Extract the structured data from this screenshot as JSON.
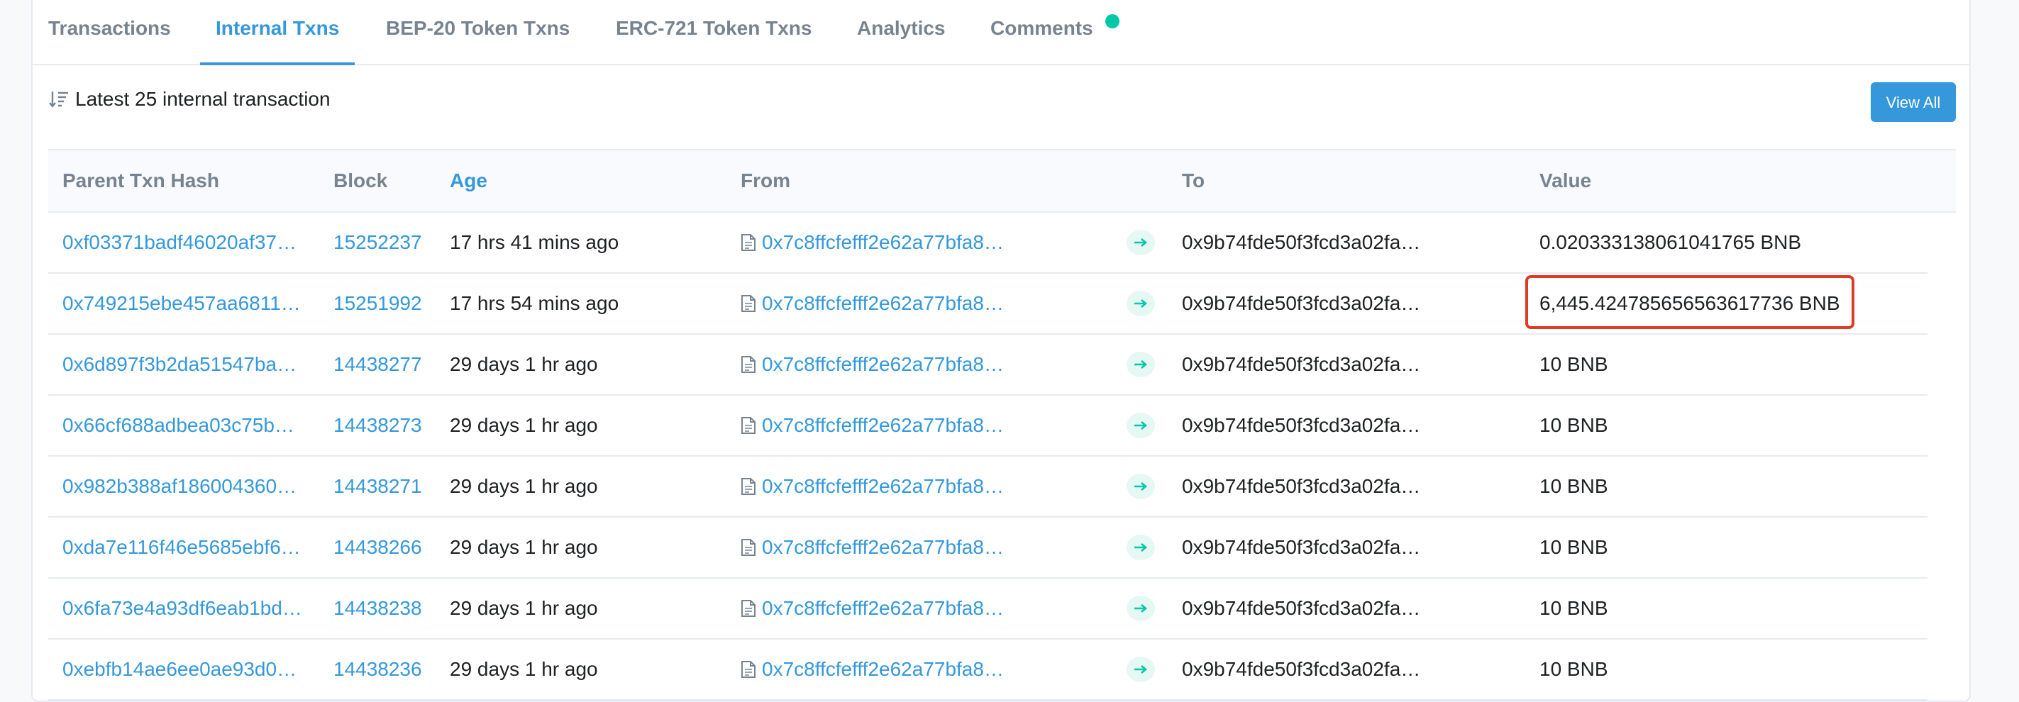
{
  "tabs": [
    {
      "label": "Transactions",
      "active": false
    },
    {
      "label": "Internal Txns",
      "active": true
    },
    {
      "label": "BEP-20 Token Txns",
      "active": false
    },
    {
      "label": "ERC-721 Token Txns",
      "active": false
    },
    {
      "label": "Analytics",
      "active": false
    },
    {
      "label": "Comments",
      "active": false
    }
  ],
  "summary": "Latest 25 internal transaction",
  "view_all_label": "View All",
  "columns": {
    "hash": "Parent Txn Hash",
    "block": "Block",
    "age": "Age",
    "from": "From",
    "to": "To",
    "value": "Value"
  },
  "rows": [
    {
      "hash": "0xf03371badf46020af37…",
      "block": "15252237",
      "age": "17 hrs 41 mins ago",
      "from": "0x7c8ffcfefff2e62a77bfa8…",
      "to": "0x9b74fde50f3fcd3a02fa…",
      "value": "0.020333138061041765 BNB",
      "highlighted": false
    },
    {
      "hash": "0x749215ebe457aa6811…",
      "block": "15251992",
      "age": "17 hrs 54 mins ago",
      "from": "0x7c8ffcfefff2e62a77bfa8…",
      "to": "0x9b74fde50f3fcd3a02fa…",
      "value": "6,445.424785656563617736 BNB",
      "highlighted": true
    },
    {
      "hash": "0x6d897f3b2da51547ba…",
      "block": "14438277",
      "age": "29 days 1 hr ago",
      "from": "0x7c8ffcfefff2e62a77bfa8…",
      "to": "0x9b74fde50f3fcd3a02fa…",
      "value": "10 BNB",
      "highlighted": false
    },
    {
      "hash": "0x66cf688adbea03c75b…",
      "block": "14438273",
      "age": "29 days 1 hr ago",
      "from": "0x7c8ffcfefff2e62a77bfa8…",
      "to": "0x9b74fde50f3fcd3a02fa…",
      "value": "10 BNB",
      "highlighted": false
    },
    {
      "hash": "0x982b388af186004360…",
      "block": "14438271",
      "age": "29 days 1 hr ago",
      "from": "0x7c8ffcfefff2e62a77bfa8…",
      "to": "0x9b74fde50f3fcd3a02fa…",
      "value": "10 BNB",
      "highlighted": false
    },
    {
      "hash": "0xda7e116f46e5685ebf6…",
      "block": "14438266",
      "age": "29 days 1 hr ago",
      "from": "0x7c8ffcfefff2e62a77bfa8…",
      "to": "0x9b74fde50f3fcd3a02fa…",
      "value": "10 BNB",
      "highlighted": false
    },
    {
      "hash": "0x6fa73e4a93df6eab1bd…",
      "block": "14438238",
      "age": "29 days 1 hr ago",
      "from": "0x7c8ffcfefff2e62a77bfa8…",
      "to": "0x9b74fde50f3fcd3a02fa…",
      "value": "10 BNB",
      "highlighted": false
    },
    {
      "hash": "0xebfb14ae6ee0ae93d0…",
      "block": "14438236",
      "age": "29 days 1 hr ago",
      "from": "0x7c8ffcfefff2e62a77bfa8…",
      "to": "0x9b74fde50f3fcd3a02fa…",
      "value": "10 BNB",
      "highlighted": false
    }
  ],
  "icons": {
    "sort": "sort-icon",
    "contract": "contract-document-icon",
    "arrow": "arrow-right-icon",
    "notification": "notification-dot-icon"
  },
  "colors": {
    "link": "#3498db",
    "accent_green": "#00c9a7",
    "highlight_border": "#dc3b26"
  }
}
